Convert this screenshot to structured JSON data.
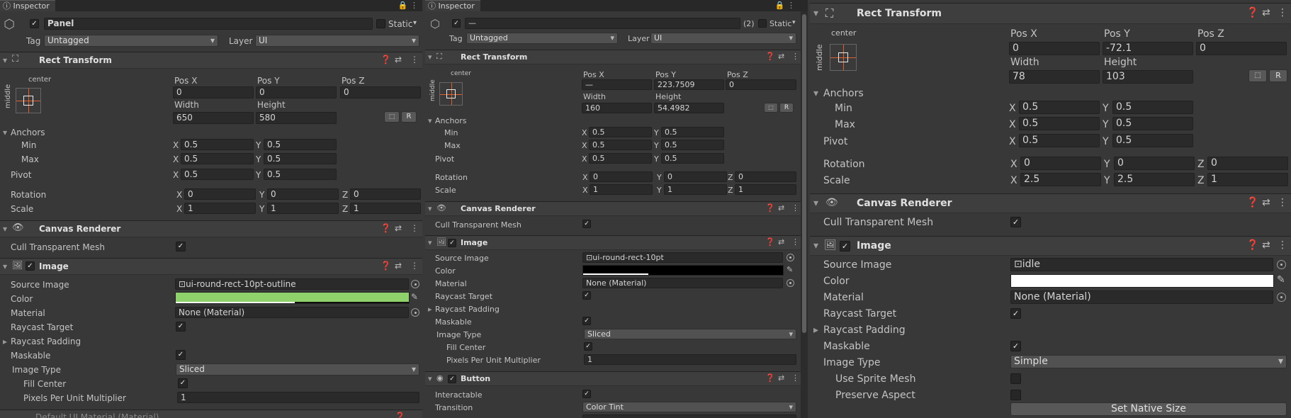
{
  "p1": {
    "tab": "Inspector",
    "name": "Panel",
    "static": "Static",
    "tag_label": "Tag",
    "tag": "Untagged",
    "layer_label": "Layer",
    "layer": "UI",
    "rt_title": "Rect Transform",
    "anchor_h": "center",
    "anchor_v": "middle",
    "posx_l": "Pos X",
    "posy_l": "Pos Y",
    "posz_l": "Pos Z",
    "posx": "0",
    "posy": "0",
    "posz": "0",
    "w_l": "Width",
    "h_l": "Height",
    "w": "650",
    "h": "580",
    "r": "R",
    "anchors": "Anchors",
    "min": "Min",
    "max": "Max",
    "pivot": "Pivot",
    "x": "X",
    "y": "Y",
    "z": "Z",
    "minx": "0.5",
    "miny": "0.5",
    "maxx": "0.5",
    "maxy": "0.5",
    "pivx": "0.5",
    "pivy": "0.5",
    "rot": "Rotation",
    "rotx": "0",
    "roty": "0",
    "rotz": "0",
    "scl": "Scale",
    "sx": "1",
    "sy": "1",
    "sz": "1",
    "cr_title": "Canvas Renderer",
    "cull": "Cull Transparent Mesh",
    "img_title": "Image",
    "src_l": "Source Image",
    "src": "ui-round-rect-10pt-outline",
    "color_l": "Color",
    "color": "#8fd16b",
    "mat_l": "Material",
    "mat": "None (Material)",
    "ray_t": "Raycast Target",
    "ray_p": "Raycast Padding",
    "mask": "Maskable",
    "itype_l": "Image Type",
    "itype": "Sliced",
    "fill": "Fill Center",
    "ppu_l": "Pixels Per Unit Multiplier",
    "ppu": "1",
    "bottom": "Default UI Material (Material)"
  },
  "p2": {
    "tab": "Inspector",
    "name": "—",
    "count": "(2)",
    "static": "Static",
    "tag_label": "Tag",
    "tag": "Untagged",
    "layer_label": "Layer",
    "layer": "UI",
    "rt_title": "Rect Transform",
    "anchor_h": "center",
    "anchor_v": "middle",
    "posx_l": "Pos X",
    "posy_l": "Pos Y",
    "posz_l": "Pos Z",
    "posx": "—",
    "posy": "223.7509",
    "posz": "0",
    "w_l": "Width",
    "h_l": "Height",
    "w": "160",
    "h": "54.4982",
    "r": "R",
    "anchors": "Anchors",
    "min": "Min",
    "max": "Max",
    "pivot": "Pivot",
    "x": "X",
    "y": "Y",
    "z": "Z",
    "minx": "0.5",
    "miny": "0.5",
    "maxx": "0.5",
    "maxy": "0.5",
    "pivx": "0.5",
    "pivy": "0.5",
    "rot": "Rotation",
    "rotx": "0",
    "roty": "0",
    "rotz": "0",
    "scl": "Scale",
    "sx": "1",
    "sy": "1",
    "sz": "1",
    "cr_title": "Canvas Renderer",
    "cull": "Cull Transparent Mesh",
    "img_title": "Image",
    "src_l": "Source Image",
    "src": "ui-round-rect-10pt",
    "color_l": "Color",
    "color": "#000000",
    "mat_l": "Material",
    "mat": "None (Material)",
    "ray_t": "Raycast Target",
    "ray_p": "Raycast Padding",
    "mask": "Maskable",
    "itype_l": "Image Type",
    "itype": "Sliced",
    "fill": "Fill Center",
    "ppu_l": "Pixels Per Unit Multiplier",
    "ppu": "1",
    "btn_title": "Button",
    "interact": "Interactable",
    "trans_l": "Transition",
    "trans": "Color Tint"
  },
  "p3": {
    "rt_title": "Rect Transform",
    "anchor_h": "center",
    "anchor_v": "middle",
    "posx_l": "Pos X",
    "posy_l": "Pos Y",
    "posz_l": "Pos Z",
    "posx": "0",
    "posy": "-72.1",
    "posz": "0",
    "w_l": "Width",
    "h_l": "Height",
    "w": "78",
    "h": "103",
    "r": "R",
    "anchors": "Anchors",
    "min": "Min",
    "max": "Max",
    "pivot": "Pivot",
    "x": "X",
    "y": "Y",
    "z": "Z",
    "minx": "0.5",
    "miny": "0.5",
    "maxx": "0.5",
    "maxy": "0.5",
    "pivx": "0.5",
    "pivy": "0.5",
    "rot": "Rotation",
    "rotx": "0",
    "roty": "0",
    "rotz": "0",
    "scl": "Scale",
    "sx": "2.5",
    "sy": "2.5",
    "sz": "1",
    "cr_title": "Canvas Renderer",
    "cull": "Cull Transparent Mesh",
    "img_title": "Image",
    "src_l": "Source Image",
    "src": "idle",
    "color_l": "Color",
    "color": "#ffffff",
    "mat_l": "Material",
    "mat": "None (Material)",
    "ray_t": "Raycast Target",
    "ray_p": "Raycast Padding",
    "mask": "Maskable",
    "itype_l": "Image Type",
    "itype": "Simple",
    "use_sprite": "Use Sprite Mesh",
    "preserve": "Preserve Aspect",
    "native": "Set Native Size"
  }
}
